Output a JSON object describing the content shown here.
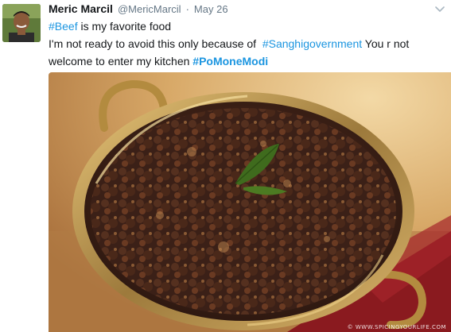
{
  "tweet": {
    "author_name": "Meric Marcil",
    "handle": "@MericMarcil",
    "separator": "·",
    "timestamp": "May 26",
    "caret_icon": "chevron-down-icon",
    "line1": {
      "hashtag": "#Beef",
      "rest": " is my favorite food"
    },
    "line2": {
      "prefix": "I'm not ready to avoid this only because of  ",
      "hashtag": "#Sanghigovernment",
      "suffix": " You r not"
    },
    "line3": {
      "prefix": "welcome to enter my kitchen ",
      "hashtag": "#PoMoneModi"
    },
    "media": {
      "watermark": "© WWW.SPICINGYOURLIFE.COM"
    }
  },
  "colors": {
    "link": "#1b95e0",
    "text": "#14171a",
    "muted": "#657786"
  }
}
